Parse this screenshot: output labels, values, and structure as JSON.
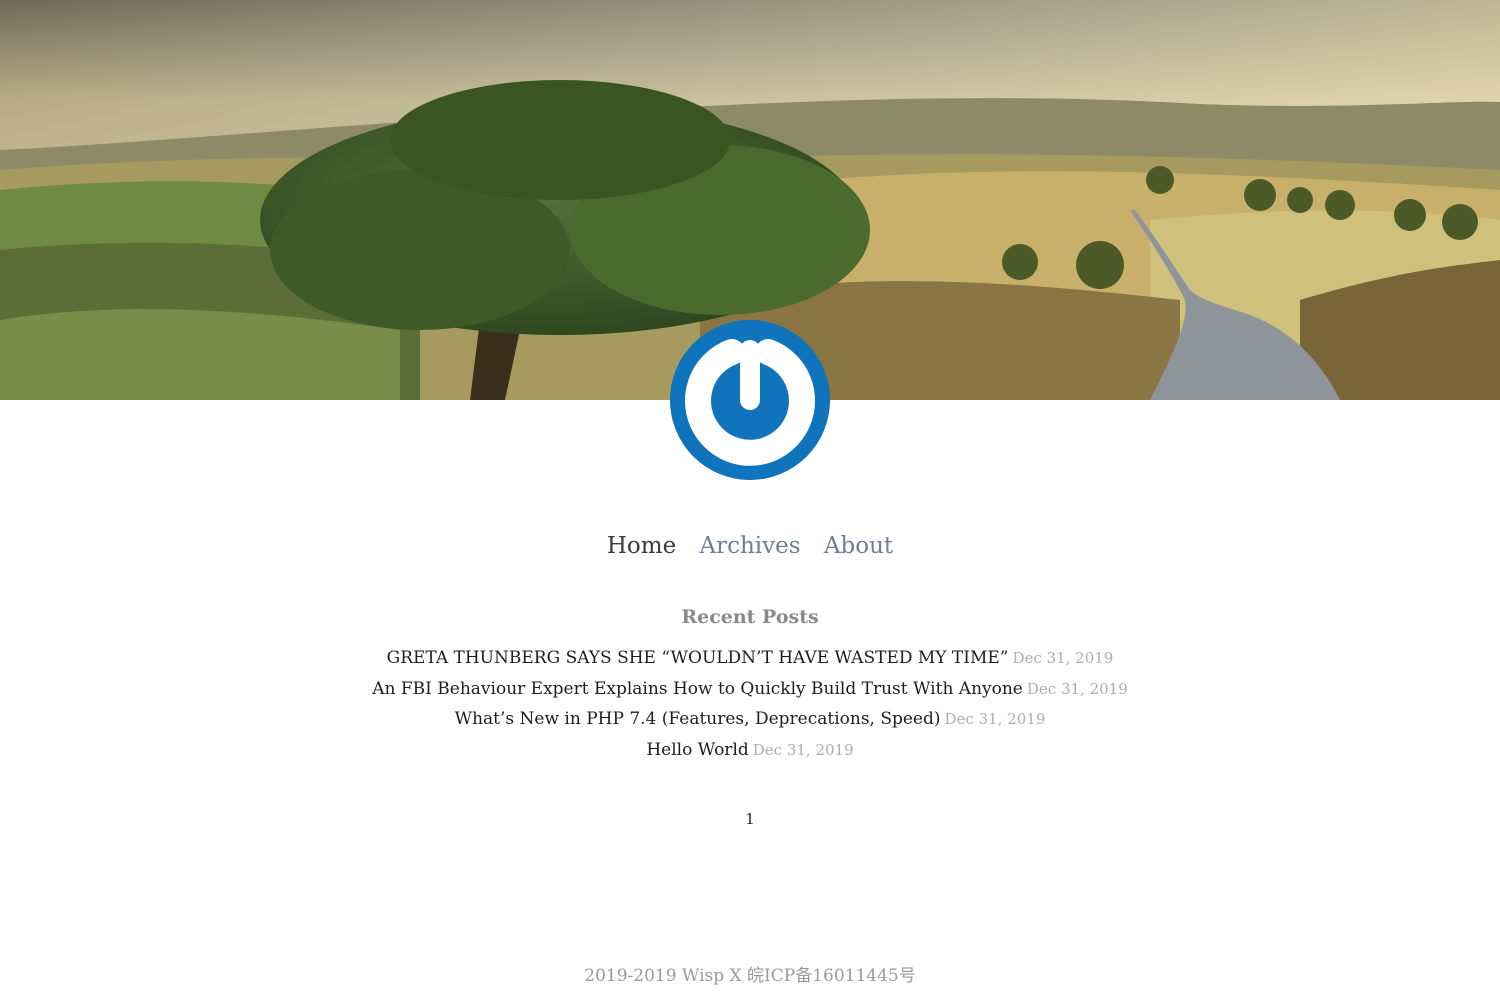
{
  "hero": {
    "image": "countryside-landscape-with-tree-and-road",
    "colors": {
      "sky": "#d9c68f",
      "tree": "#3f5a24",
      "road": "#8e949a",
      "hills": "#b8a460"
    }
  },
  "avatar": {
    "icon": "power-logo-icon",
    "colors": {
      "background": "#0f74bc",
      "ring": "#ffffff"
    }
  },
  "nav": {
    "items": [
      {
        "label": "Home"
      },
      {
        "label": "Archives"
      },
      {
        "label": "About"
      }
    ],
    "active": "Home"
  },
  "recent": {
    "title": "Recent Posts",
    "posts": [
      {
        "title": "GRETA THUNBERG SAYS SHE “WOULDN’T HAVE WASTED MY TIME”",
        "date": "Dec 31, 2019"
      },
      {
        "title": "An FBI Behaviour Expert Explains How to Quickly Build Trust With Anyone",
        "date": "Dec 31, 2019"
      },
      {
        "title": "What’s New in PHP 7.4 (Features, Deprecations, Speed)",
        "date": "Dec 31, 2019"
      },
      {
        "title": "Hello World",
        "date": "Dec 31, 2019"
      }
    ]
  },
  "pagination": {
    "current": "1"
  },
  "footer": {
    "text": "2019-2019 Wisp X 皖ICP备16011445号"
  }
}
